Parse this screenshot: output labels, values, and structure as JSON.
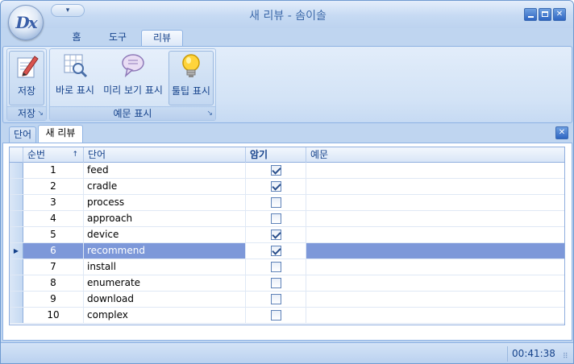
{
  "window": {
    "title": "새 리뷰 - 솜이솔",
    "logo_text": "Dx",
    "qat_glyph": "▾"
  },
  "ribbon": {
    "tabs": [
      {
        "label": "홈"
      },
      {
        "label": "도구"
      },
      {
        "label": "리뷰"
      }
    ],
    "active_tab": "리뷰",
    "groups": {
      "save": {
        "label": "저장",
        "buttons": [
          {
            "label": "저장",
            "icon": "pencil-paper-icon"
          }
        ]
      },
      "example": {
        "label": "예문 표시",
        "buttons": [
          {
            "label": "바로 표시",
            "icon": "grid-magnifier-icon"
          },
          {
            "label": "미리 보기 표시",
            "icon": "speech-bubble-icon"
          },
          {
            "label": "툴팁 표시",
            "icon": "lightbulb-icon",
            "pressed": true
          }
        ]
      }
    },
    "launcher_glyph": "↘"
  },
  "doc_tabs": [
    {
      "label": "단어"
    },
    {
      "label": "새 리뷰",
      "active": true
    }
  ],
  "grid": {
    "columns": {
      "num": "순번",
      "word": "단어",
      "memorized": "암기",
      "example": "예문"
    },
    "sort_glyph": "↑",
    "current_row_glyph": "▶",
    "rows": [
      {
        "num": "1",
        "word": "feed",
        "memorized": true,
        "example": ""
      },
      {
        "num": "2",
        "word": "cradle",
        "memorized": true,
        "example": ""
      },
      {
        "num": "3",
        "word": "process",
        "memorized": false,
        "example": ""
      },
      {
        "num": "4",
        "word": "approach",
        "memorized": false,
        "example": ""
      },
      {
        "num": "5",
        "word": "device",
        "memorized": true,
        "example": ""
      },
      {
        "num": "6",
        "word": "recommend",
        "memorized": true,
        "example": "",
        "selected": true
      },
      {
        "num": "7",
        "word": "install",
        "memorized": false,
        "example": ""
      },
      {
        "num": "8",
        "word": "enumerate",
        "memorized": false,
        "example": ""
      },
      {
        "num": "9",
        "word": "download",
        "memorized": false,
        "example": ""
      },
      {
        "num": "10",
        "word": "complex",
        "memorized": false,
        "example": ""
      }
    ]
  },
  "status": {
    "time": "00:41:38"
  },
  "colors": {
    "selection": "#7d98d9",
    "accent": "#15428b",
    "pressed_button": "#f8d777"
  }
}
